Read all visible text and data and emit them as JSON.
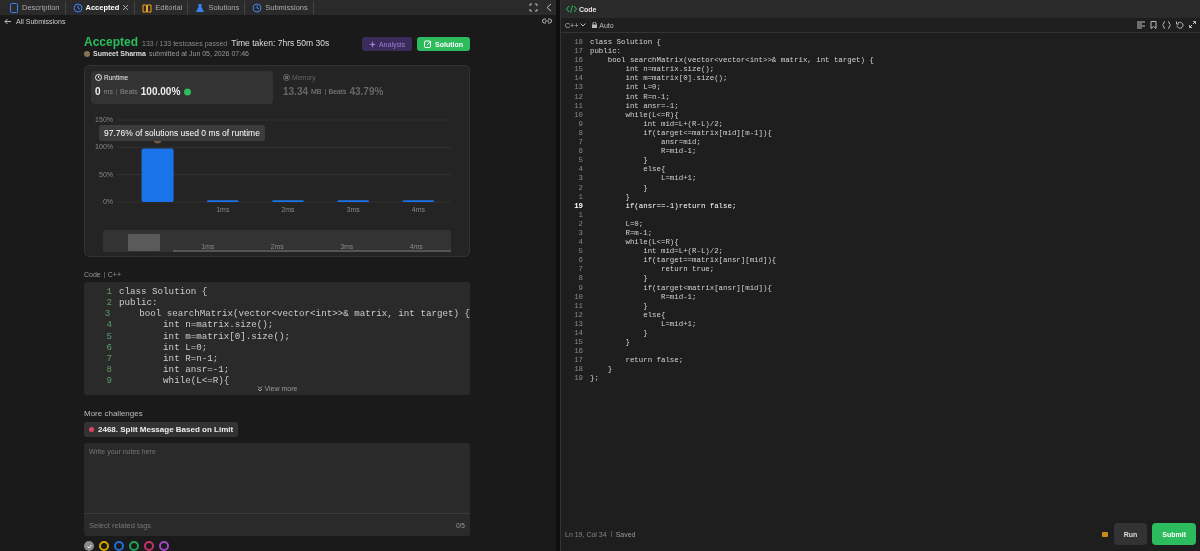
{
  "tabs": [
    {
      "label": "Description",
      "selected": false,
      "closable": false,
      "kind": "doc"
    },
    {
      "label": "Accepted",
      "selected": true,
      "closable": true,
      "kind": "history"
    },
    {
      "label": "Editorial",
      "selected": false,
      "closable": false,
      "kind": "book"
    },
    {
      "label": "Solutions",
      "selected": false,
      "closable": false,
      "kind": "flask"
    },
    {
      "label": "Submissions",
      "selected": false,
      "closable": false,
      "kind": "history"
    }
  ],
  "back_link": "All Submissions",
  "result": {
    "status": "Accepted",
    "testcases": "133 / 133 testcases passed",
    "time_taken": "Time taken: 7hrs 50m 30s",
    "author": "Sumeet Sharma",
    "submitted": "submitted at Jun 05, 2026 07:46"
  },
  "buttons": [
    {
      "label": "Analysis",
      "kind": "analysis"
    },
    {
      "label": "Solution",
      "kind": "solution"
    }
  ],
  "metrics": [
    {
      "label": "Runtime",
      "kind": "runtime",
      "value": "0",
      "unit": "ms",
      "beats_label": "Beats",
      "beats": "100.00%",
      "selected": true
    },
    {
      "label": "Memory",
      "kind": "memory",
      "value": "13.34",
      "unit": "MB",
      "beats_label": "Beats",
      "beats": "43.79%",
      "selected": false
    }
  ],
  "chart": {
    "tooltip": "97.76% of solutions used 0 ms of runtime",
    "chart_data": {
      "type": "bar",
      "categories": [
        null,
        "1ms",
        "2ms",
        "3ms",
        "4ms"
      ],
      "values": [
        98,
        3,
        3,
        3,
        3
      ],
      "ylim": [
        0,
        150
      ],
      "yticks": [
        {
          "value": 0,
          "label": "0%"
        },
        {
          "value": 50,
          "label": "50%"
        },
        {
          "value": 100,
          "label": "100%"
        },
        {
          "value": 150,
          "label": "150%"
        }
      ]
    },
    "navigator_labels": [
      "1ms",
      "2ms",
      "3ms",
      "4ms"
    ]
  },
  "code_header": {
    "label": "Code",
    "language": "C++"
  },
  "code_preview": {
    "view_more": "View more",
    "lines": [
      {
        "number": "1",
        "text": "class Solution {"
      },
      {
        "number": "2",
        "text": "public:"
      },
      {
        "number": "3",
        "text": "    bool searchMatrix(vector<vector<int>>& matrix, int target) {"
      },
      {
        "number": "4",
        "text": "        int n=matrix.size();"
      },
      {
        "number": "5",
        "text": "        int m=matrix[0].size();"
      },
      {
        "number": "6",
        "text": "        int L=0;"
      },
      {
        "number": "7",
        "text": "        int R=n-1;"
      },
      {
        "number": "8",
        "text": "        int ansr=-1;"
      },
      {
        "number": "9",
        "text": "        while(L<=R){"
      }
    ]
  },
  "more_challenges": {
    "title": "More challenges",
    "items": [
      {
        "label": "2468. Split Message Based on Limit",
        "color": "#e0455f"
      }
    ]
  },
  "notes": {
    "placeholder": "Write your notes here",
    "tags_placeholder": "Select related tags",
    "tags_count": "0/5"
  },
  "note_colors": [
    {
      "color": "#8a8a8a",
      "selected": true
    },
    {
      "color": "#d9a400",
      "selected": false
    },
    {
      "color": "#1f6fd6",
      "selected": false
    },
    {
      "color": "#1ea35a",
      "selected": false
    },
    {
      "color": "#c7306a",
      "selected": false
    },
    {
      "color": "#a347c7",
      "selected": false
    }
  ],
  "editor": {
    "title": "Code",
    "language": "C++",
    "mode": "Auto",
    "lines": [
      {
        "number": "18",
        "text": "class Solution {",
        "current": false
      },
      {
        "number": "17",
        "text": "public:",
        "current": false
      },
      {
        "number": "16",
        "text": "    bool searchMatrix(vector<vector<int>>& matrix, int target) {",
        "current": false
      },
      {
        "number": "15",
        "text": "        int n=matrix.size();",
        "current": false
      },
      {
        "number": "14",
        "text": "        int m=matrix[0].size();",
        "current": false
      },
      {
        "number": "13",
        "text": "        int L=0;",
        "current": false
      },
      {
        "number": "12",
        "text": "        int R=n-1;",
        "current": false
      },
      {
        "number": "11",
        "text": "        int ansr=-1;",
        "current": false
      },
      {
        "number": "10",
        "text": "        while(L<=R){",
        "current": false
      },
      {
        "number": "9",
        "text": "            int mid=L+(R-L)/2;",
        "current": false
      },
      {
        "number": "8",
        "text": "            if(target<=matrix[mid][m-1]){",
        "current": false
      },
      {
        "number": "7",
        "text": "                ansr=mid;",
        "current": false
      },
      {
        "number": "6",
        "text": "                R=mid-1;",
        "current": false
      },
      {
        "number": "5",
        "text": "            }",
        "current": false
      },
      {
        "number": "4",
        "text": "            else{",
        "current": false
      },
      {
        "number": "3",
        "text": "                L=mid+1;",
        "current": false
      },
      {
        "number": "2",
        "text": "            }",
        "current": false
      },
      {
        "number": "1",
        "text": "        }",
        "current": false
      },
      {
        "number": "19",
        "text": "        if(ansr==-1)return false;",
        "current": true
      },
      {
        "number": "1",
        "current": false
      },
      {
        "number": "2",
        "text": "        L=0;",
        "current": false
      },
      {
        "number": "3",
        "text": "        R=m-1;",
        "current": false
      },
      {
        "number": "4",
        "text": "        while(L<=R){",
        "current": false
      },
      {
        "number": "5",
        "text": "            int mid=L+(R-L)/2;",
        "current": false
      },
      {
        "number": "6",
        "text": "            if(target==matrix[ansr][mid]){",
        "current": false
      },
      {
        "number": "7",
        "text": "                return true;",
        "current": false
      },
      {
        "number": "8",
        "text": "            }",
        "current": false
      },
      {
        "number": "9",
        "text": "            if(target<matrix[ansr][mid]){",
        "current": false
      },
      {
        "number": "10",
        "text": "                R=mid-1;",
        "current": false
      },
      {
        "number": "11",
        "text": "            }",
        "current": false
      },
      {
        "number": "12",
        "text": "            else{",
        "current": false
      },
      {
        "number": "13",
        "text": "                L=mid+1;",
        "current": false
      },
      {
        "number": "14",
        "text": "            }",
        "current": false
      },
      {
        "number": "15",
        "text": "        }",
        "current": false
      },
      {
        "number": "16",
        "current": false
      },
      {
        "number": "17",
        "text": "        return false;",
        "current": false
      },
      {
        "number": "18",
        "text": "    }",
        "current": false
      },
      {
        "number": "19",
        "text": "};",
        "current": false
      }
    ],
    "status": {
      "position": "Ln 19, Col 34",
      "saved": "Saved"
    }
  },
  "actions": [
    {
      "label": "Run",
      "kind": "run"
    },
    {
      "label": "Submit",
      "kind": "submit"
    }
  ]
}
